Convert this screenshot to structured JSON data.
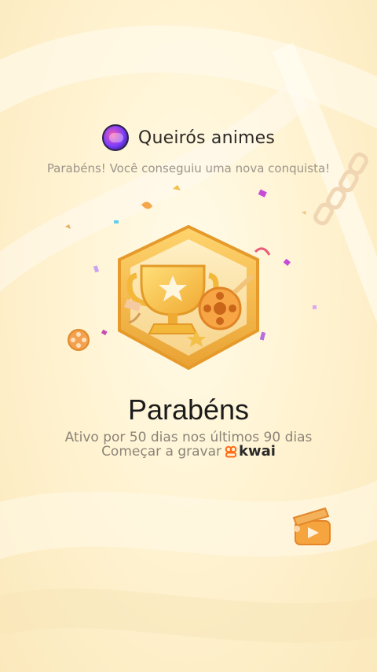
{
  "header": {
    "username": "Queirós animes"
  },
  "subtitle": "Parabéns! Você conseguiu uma nova conquista!",
  "achievement": {
    "title": "Parabéns",
    "description": "Ativo por 50 dias nos últimos 90 dias"
  },
  "footer": {
    "record_label": "Começar a gravar",
    "brand": "kwai"
  },
  "colors": {
    "background": "#fff3d2",
    "badge_gold": "#f3b73a",
    "brand_orange": "#ff6a13",
    "confetti_purple": "#c64bd8"
  },
  "icons": {
    "badge": "trophy-badge-icon",
    "film_reel": "film-reel-icon",
    "clapperboard": "clapperboard-icon",
    "kwai_logo": "kwai-logo-icon"
  }
}
